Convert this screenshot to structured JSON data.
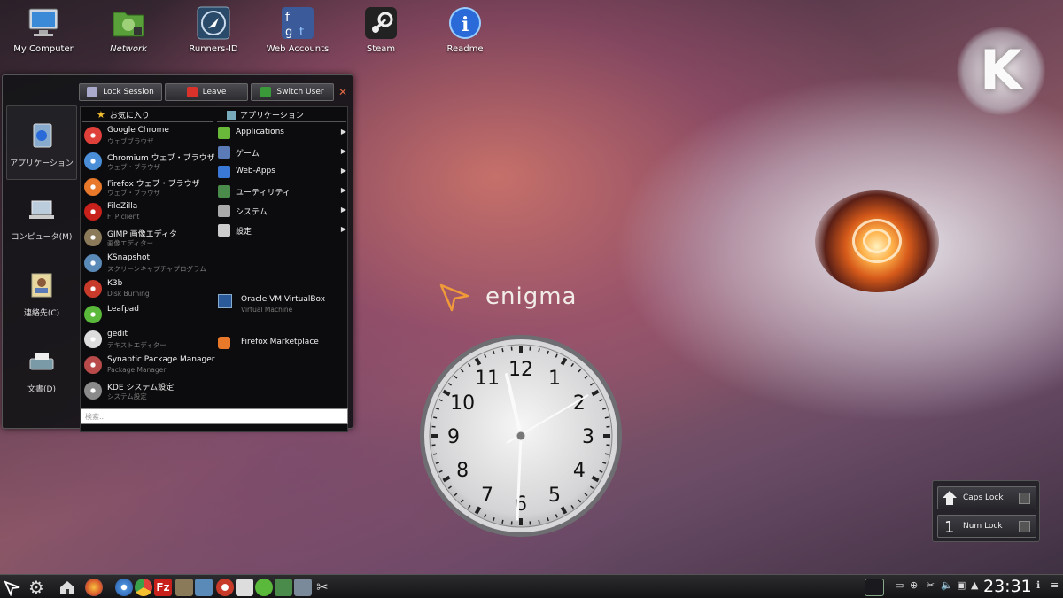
{
  "desktop_icons": [
    {
      "label": "My Computer",
      "icon": "computer-icon"
    },
    {
      "label": "Network",
      "icon": "network-folder-icon"
    },
    {
      "label": "Runners-ID",
      "icon": "runners-id-icon"
    },
    {
      "label": "Web Accounts",
      "icon": "web-accounts-icon"
    },
    {
      "label": "Steam",
      "icon": "steam-icon"
    },
    {
      "label": "Readme",
      "icon": "info-icon"
    }
  ],
  "menu": {
    "top_buttons": {
      "lock": "Lock Session",
      "leave": "Leave",
      "switch": "Switch User"
    },
    "sidebar": [
      {
        "label": "アプリケーション",
        "icon": "applications-icon"
      },
      {
        "label": "コンピュータ(M)",
        "icon": "laptop-icon"
      },
      {
        "label": "連絡先(C)",
        "icon": "contacts-icon"
      },
      {
        "label": "文書(D)",
        "icon": "typewriter-icon"
      }
    ],
    "favorites_header": "お気に入り",
    "applications_header": "アプリケーション",
    "favorites": [
      {
        "name": "Google Chrome",
        "desc": "ウェブブラウザ",
        "color": "#e0403a"
      },
      {
        "name": "Chromium ウェブ・ブラウザ",
        "desc": "ウェブ・ブラウザ",
        "color": "#4a8ed8"
      },
      {
        "name": "Firefox ウェブ・ブラウザ",
        "desc": "ウェブ・ブラウザ",
        "color": "#e8782a"
      },
      {
        "name": "FileZilla",
        "desc": "FTP client",
        "color": "#c8201a"
      },
      {
        "name": "GIMP 画像エディタ",
        "desc": "画像エディター",
        "color": "#8a7a5a"
      },
      {
        "name": "KSnapshot",
        "desc": "スクリーンキャプチャプログラム",
        "color": "#5a8ab8"
      },
      {
        "name": "K3b",
        "desc": "Disk Burning",
        "color": "#c83a2a"
      },
      {
        "name": "Leafpad",
        "desc": "",
        "color": "#5ab83a"
      },
      {
        "name": "gedit",
        "desc": "テキストエディター",
        "color": "#dddddd"
      },
      {
        "name": "Synaptic Package Manager",
        "desc": "Package Manager",
        "color": "#b84a4a"
      },
      {
        "name": "KDE システム設定",
        "desc": "システム設定",
        "color": "#8a8a8a"
      }
    ],
    "applications": [
      {
        "name": "Applications",
        "has_sub": true,
        "color": "#6ab83a"
      },
      {
        "name": "ゲーム",
        "has_sub": true,
        "color": "#5a7ab8"
      },
      {
        "name": "Web-Apps",
        "has_sub": true,
        "color": "#3a78d8"
      },
      {
        "name": "ユーティリティ",
        "has_sub": true,
        "color": "#4a8a4a"
      },
      {
        "name": "システム",
        "has_sub": true,
        "color": "#aaaaaa"
      },
      {
        "name": "設定",
        "has_sub": true,
        "color": "#cccccc"
      }
    ],
    "virtualbox": {
      "name": "Oracle VM VirtualBox",
      "desc": "Virtual Machine"
    },
    "marketplace": {
      "name": "Firefox Marketplace"
    },
    "search_placeholder": "検索..."
  },
  "wallpaper_text": "enigma",
  "clock_face": {
    "numbers": [
      "12",
      "1",
      "2",
      "3",
      "4",
      "5",
      "6",
      "7",
      "8",
      "9",
      "10",
      "11"
    ]
  },
  "lock_widget": {
    "caps": "Caps Lock",
    "num": "Num Lock"
  },
  "taskbar": {
    "time": "23:31"
  },
  "colors": {
    "accent_orange": "#f09a3a",
    "menu_bg": "#141418"
  }
}
